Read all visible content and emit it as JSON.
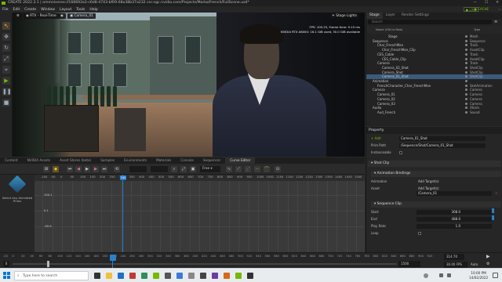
{
  "titlebar": {
    "text": "CREATE 2022.3.1 | ommniverse://168693a3-c6d8-4743-bf09-08a38b37a232 cnr.ngc.nvidia.com/Projects/Marko/French/FullScene.usd*",
    "min": "—",
    "max": "☐",
    "close": "✕"
  },
  "menu": {
    "items": [
      "File",
      "Edit",
      "Create",
      "Window",
      "Layout",
      "Tools",
      "Help"
    ],
    "live": "● LIVE",
    "cache": "● CACHE",
    "extra": "⌵"
  },
  "viewport": {
    "render_mode": "RTX - Real-Time",
    "camera": "Camera_01",
    "stage_lights": "Stage Lights",
    "stats": [
      "FPS: 100.25, Frame time: 9.15 ms",
      "NVIDIA RTX A6000: 16.1 GiB used, 30.0 GiB available"
    ]
  },
  "stage": {
    "tabs": [
      "Stage",
      "Layer",
      "Render Settings"
    ],
    "search_placeholder": "Search",
    "col_name": "Name (Old to New)",
    "col_type": "Type",
    "rows": [
      {
        "name": "Stage",
        "type": "Mesh",
        "indent": 28,
        "sel": false
      },
      {
        "name": "Sequence",
        "type": "Sequence",
        "indent": 8,
        "sel": false
      },
      {
        "name": "Char_FrenchMan",
        "type": "Track",
        "indent": 14,
        "sel": false
      },
      {
        "name": "Char_FrenchMan_Clip",
        "type": "AssetClip",
        "indent": 20,
        "sel": false
      },
      {
        "name": "CES_Cable",
        "type": "Track",
        "indent": 14,
        "sel": false
      },
      {
        "name": "CES_Cable_Clip",
        "type": "AssetClip",
        "indent": 20,
        "sel": false
      },
      {
        "name": "Camera",
        "type": "Track",
        "indent": 14,
        "sel": false
      },
      {
        "name": "Camera_02_Shot",
        "type": "ShotClip",
        "indent": 20,
        "sel": false
      },
      {
        "name": "Camera_Shot",
        "type": "ShotClip",
        "indent": 20,
        "sel": false
      },
      {
        "name": "Camera_01_Shot",
        "type": "ShotClip",
        "indent": 20,
        "sel": true
      },
      {
        "name": "Animation",
        "type": "",
        "indent": 8,
        "sel": false
      },
      {
        "name": "FrenchCharacter_Char_FrenchMan",
        "type": "SkelAnimation",
        "indent": 14,
        "sel": false
      },
      {
        "name": "Camera",
        "type": "Camera",
        "indent": 8,
        "sel": false
      },
      {
        "name": "Camera_01",
        "type": "Camera",
        "indent": 14,
        "sel": false
      },
      {
        "name": "Camera_02",
        "type": "Camera",
        "indent": 14,
        "sel": false
      },
      {
        "name": "Camera_03",
        "type": "Camera",
        "indent": 14,
        "sel": false
      },
      {
        "name": "Audio",
        "type": "Xform",
        "indent": 8,
        "sel": false
      },
      {
        "name": "Aud_French",
        "type": "Sound",
        "indent": 14,
        "sel": false
      }
    ]
  },
  "property": {
    "title": "Property",
    "add_label": "+ Add",
    "name_value": "Camera_01_Shot",
    "prim_path_label": "Prim Path",
    "prim_path": "/Sequence/Shot/Camera_01_Shot",
    "instanceable_label": "Instanceable",
    "sections": {
      "shot_clip": "Shot Clip",
      "anim_bindings": "Animation Bindings",
      "seq_clip": "Sequence Clip"
    },
    "animation_label": "Animation",
    "add_target": "Add Target(s)",
    "asset_label": "Asset",
    "asset_value": "/Camera_01",
    "start_label": "Start",
    "start_value": "308.0",
    "end_label": "End",
    "end_value": "488.0",
    "play_rate_label": "Play Rate",
    "play_rate_value": "1.0",
    "loop_label": "Loop"
  },
  "bottom_tabs": [
    "Content",
    "NVIDIA Assets",
    "Asset Stores (beta)",
    "Samples",
    "Environments",
    "Materials",
    "Console",
    "Sequencer",
    "Curve Editor"
  ],
  "curve_editor": {
    "no_prim": "Select Any Animated Prims",
    "mode": "Free",
    "ruler": [
      "-100",
      "-50",
      "0",
      "50",
      "100",
      "150",
      "200",
      "250",
      "300",
      "350",
      "400",
      "450",
      "500",
      "550",
      "600",
      "650",
      "700",
      "750",
      "800",
      "850",
      "900",
      "950",
      "1000",
      "1050",
      "1100",
      "1150",
      "1200",
      "1250",
      "1300",
      "1350",
      "1400",
      "1450",
      "1500"
    ],
    "ylabels": [
      "100.1",
      "0.1",
      "-99.9"
    ],
    "playhead": "345"
  },
  "timeline": {
    "ruler": [
      "-20",
      "0",
      "20",
      "40",
      "60",
      "80",
      "100",
      "120",
      "140",
      "160",
      "180",
      "200",
      "220",
      "240",
      "260",
      "280",
      "300",
      "320",
      "340",
      "360",
      "380",
      "400",
      "420",
      "440",
      "460",
      "480",
      "500",
      "520",
      "540",
      "560",
      "580",
      "600",
      "620",
      "640",
      "660",
      "680",
      "700",
      "720",
      "740",
      "760",
      "780",
      "800",
      "820",
      "840",
      "860",
      "880",
      "900",
      "920"
    ],
    "start": "0",
    "end": "1500",
    "current": "314.70",
    "fps": "30.00 FPS",
    "auto": "Auto"
  },
  "taskbar": {
    "search_placeholder": "Type here to search",
    "time": "10:00 PM",
    "date": "14/02/2022"
  }
}
